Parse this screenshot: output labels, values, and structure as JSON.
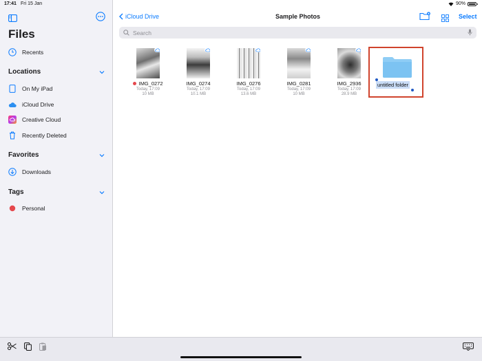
{
  "status": {
    "time": "17:41",
    "date": "Fri 15 Jan",
    "battery": "90%"
  },
  "sidebar": {
    "title": "Files",
    "recents": "Recents",
    "locations_header": "Locations",
    "locations": [
      "On My iPad",
      "iCloud Drive",
      "Creative Cloud",
      "Recently Deleted"
    ],
    "favorites_header": "Favorites",
    "favorites": [
      "Downloads"
    ],
    "tags_header": "Tags",
    "tags": [
      {
        "label": "Personal",
        "color": "#e5484d"
      }
    ]
  },
  "nav": {
    "back_label": "iCloud Drive",
    "title": "Sample Photos",
    "select_label": "Select"
  },
  "search": {
    "placeholder": "Search"
  },
  "files": [
    {
      "name": "IMG_0272",
      "date": "Today, 17:09",
      "size": "10 MB",
      "tag_color": "#e5484d"
    },
    {
      "name": "IMG_0274",
      "date": "Today, 17:09",
      "size": "10.1 MB"
    },
    {
      "name": "IMG_0276",
      "date": "Today, 17:09",
      "size": "13.6 MB"
    },
    {
      "name": "IMG_0281",
      "date": "Today, 17:09",
      "size": "10 MB"
    },
    {
      "name": "IMG_2936",
      "date": "Today, 17:09",
      "size": "28.9 MB"
    }
  ],
  "new_folder": {
    "name": "untitled folder"
  },
  "colors": {
    "accent": "#0a7bff",
    "highlight": "#d0432c",
    "folder": "#7cc3f2"
  }
}
